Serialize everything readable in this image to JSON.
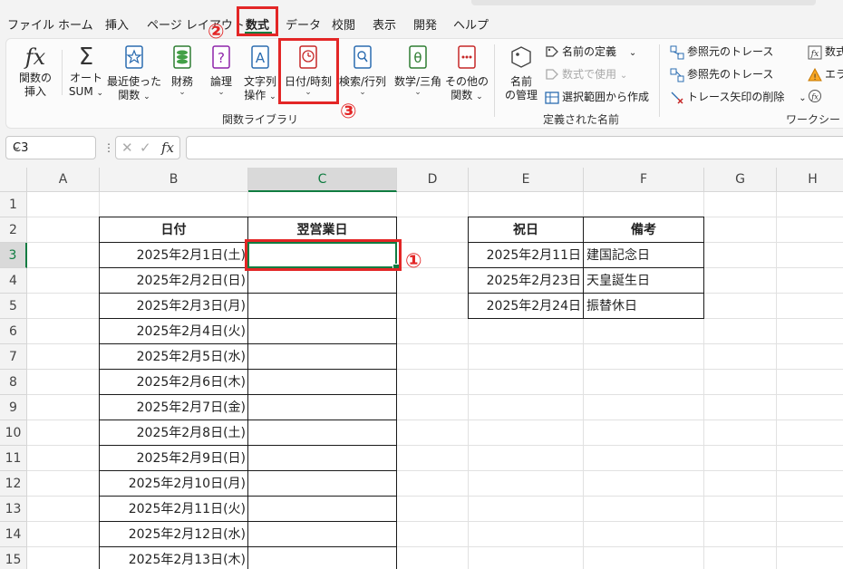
{
  "tabs": [
    "ファイル",
    "ホーム",
    "挿入",
    "ページ レイアウト",
    "数式",
    "データ",
    "校閲",
    "表示",
    "開発",
    "ヘルプ"
  ],
  "active_tab": "数式",
  "ribbon": {
    "function_library": {
      "insert_function": {
        "line1": "関数の",
        "line2": "挿入"
      },
      "autosum": {
        "line1": "オート",
        "line2": "SUM"
      },
      "recent": {
        "line1": "最近使った",
        "line2": "関数"
      },
      "financial": {
        "line1": "財務"
      },
      "logical": {
        "line1": "論理"
      },
      "text": {
        "line1": "文字列",
        "line2": "操作"
      },
      "datetime": {
        "line1": "日付/時刻"
      },
      "lookup": {
        "line1": "検索/行列"
      },
      "math": {
        "line1": "数学/三角"
      },
      "more": {
        "line1": "その他の",
        "line2": "関数"
      },
      "group_label": "関数ライブラリ"
    },
    "defined_names": {
      "name_manager": {
        "line1": "名前",
        "line2": "の管理"
      },
      "define_name": "名前の定義",
      "use_in_formula": "数式で使用",
      "create_from_selection": "選択範囲から作成",
      "group_label": "定義された名前"
    },
    "auditing": {
      "trace_precedents": "参照元のトレース",
      "trace_dependents": "参照先のトレース",
      "remove_arrows": "トレース矢印の削除",
      "show_formulas": "数式",
      "error_checking": "エラ",
      "group_label": "ワークシート分析"
    }
  },
  "formula_bar": {
    "name_box": "C3",
    "fx": "fx",
    "formula": ""
  },
  "columns": [
    "A",
    "B",
    "C",
    "D",
    "E",
    "F",
    "G",
    "H"
  ],
  "rows": [
    "1",
    "2",
    "3",
    "4",
    "5",
    "6",
    "7",
    "8",
    "9",
    "10",
    "11",
    "12",
    "13",
    "14",
    "15"
  ],
  "selected_cell": "C3",
  "table1": {
    "headers": [
      "日付",
      "翌営業日"
    ],
    "dates": [
      "2025年2月1日(土)",
      "2025年2月2日(日)",
      "2025年2月3日(月)",
      "2025年2月4日(火)",
      "2025年2月5日(水)",
      "2025年2月6日(木)",
      "2025年2月7日(金)",
      "2025年2月8日(土)",
      "2025年2月9日(日)",
      "2025年2月10日(月)",
      "2025年2月11日(火)",
      "2025年2月12日(水)",
      "2025年2月13日(木)"
    ]
  },
  "table2": {
    "headers": [
      "祝日",
      "備考"
    ],
    "rows": [
      {
        "date": "2025年2月11日",
        "note": "建国記念日"
      },
      {
        "date": "2025年2月23日",
        "note": "天皇誕生日"
      },
      {
        "date": "2025年2月24日",
        "note": "振替休日"
      }
    ]
  },
  "annotations": {
    "step1": "①",
    "step2": "②",
    "step3": "③"
  },
  "colors": {
    "accent": "#107c41",
    "annotation": "#e32626"
  }
}
